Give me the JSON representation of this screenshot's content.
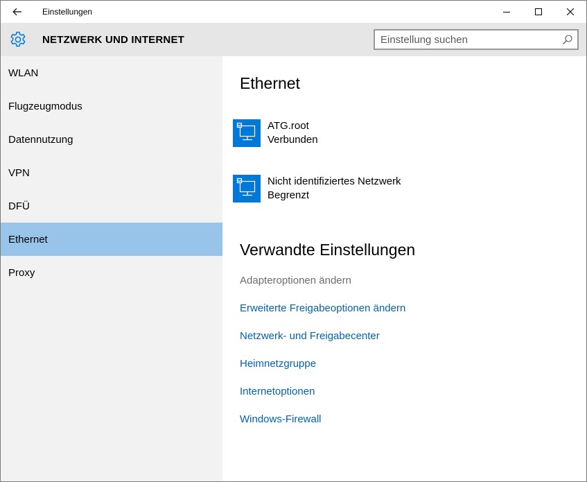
{
  "window": {
    "title": "Einstellungen"
  },
  "header": {
    "section_title": "NETZWERK UND INTERNET",
    "search_placeholder": "Einstellung suchen"
  },
  "sidebar": {
    "items": [
      {
        "label": "WLAN"
      },
      {
        "label": "Flugzeugmodus"
      },
      {
        "label": "Datennutzung"
      },
      {
        "label": "VPN"
      },
      {
        "label": "DFÜ"
      },
      {
        "label": "Ethernet",
        "selected": true
      },
      {
        "label": "Proxy"
      }
    ]
  },
  "main": {
    "heading": "Ethernet",
    "networks": [
      {
        "name": "ATG.root",
        "status": "Verbunden",
        "icon": "ethernet-icon"
      },
      {
        "name": "Nicht identifiziertes Netzwerk",
        "status": "Begrenzt",
        "icon": "ethernet-icon"
      }
    ],
    "related_heading": "Verwandte Einstellungen",
    "related_links": [
      {
        "label": "Adapteroptionen ändern",
        "enabled": false
      },
      {
        "label": "Erweiterte Freigabeoptionen ändern",
        "enabled": true
      },
      {
        "label": "Netzwerk- und Freigabecenter",
        "enabled": true
      },
      {
        "label": "Heimnetzgruppe",
        "enabled": true
      },
      {
        "label": "Internetoptionen",
        "enabled": true
      },
      {
        "label": "Windows-Firewall",
        "enabled": true
      }
    ]
  },
  "colors": {
    "accent": "#0078d7",
    "link": "#0063b1",
    "selected_nav": "#99c4ea",
    "header_bg": "#e6e6e6",
    "sidebar_bg": "#f2f2f2"
  }
}
